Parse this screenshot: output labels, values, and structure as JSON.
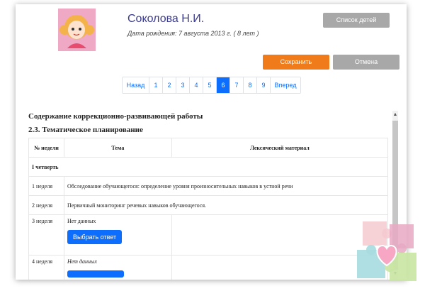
{
  "profile": {
    "name": "Соколова Н.И.",
    "birth": "Дата рождения: 7 августа 2013 г. ( 8 лет )"
  },
  "buttons": {
    "children_list": "Список детей",
    "save": "Сохранить",
    "cancel": "Отмена"
  },
  "pagination": {
    "prev": "Назад",
    "pages": [
      "1",
      "2",
      "3",
      "4",
      "5",
      "6",
      "7",
      "8",
      "9"
    ],
    "active": "6",
    "next": "Вперед"
  },
  "section": {
    "title": "Содержание коррекционно-развивающей работы",
    "subtitle": "2.3. Тематическое планирование"
  },
  "table": {
    "headers": [
      "№ недели",
      "Тема",
      "Лексический материал"
    ],
    "quarter": "I четверть",
    "rows": [
      {
        "week": "1 неделя",
        "topic": "Обследование обучающегося: определение уровня произносительных навыков в устной речи",
        "lexical": ""
      },
      {
        "week": "2 неделя",
        "topic": "Первичный мониторинг речевых навыков обучающегося.",
        "lexical": ""
      },
      {
        "week": "3 неделя",
        "topic": "Нет данных",
        "button": "Выбрать ответ",
        "lexical": ""
      },
      {
        "week": "4 неделя",
        "topic": "Нет данных",
        "lexical": ""
      }
    ]
  },
  "colors": {
    "primary": "#0d6efd",
    "save": "#f07b1a",
    "grey_button": "#a8a8a8",
    "name": "#3b3b8f"
  }
}
